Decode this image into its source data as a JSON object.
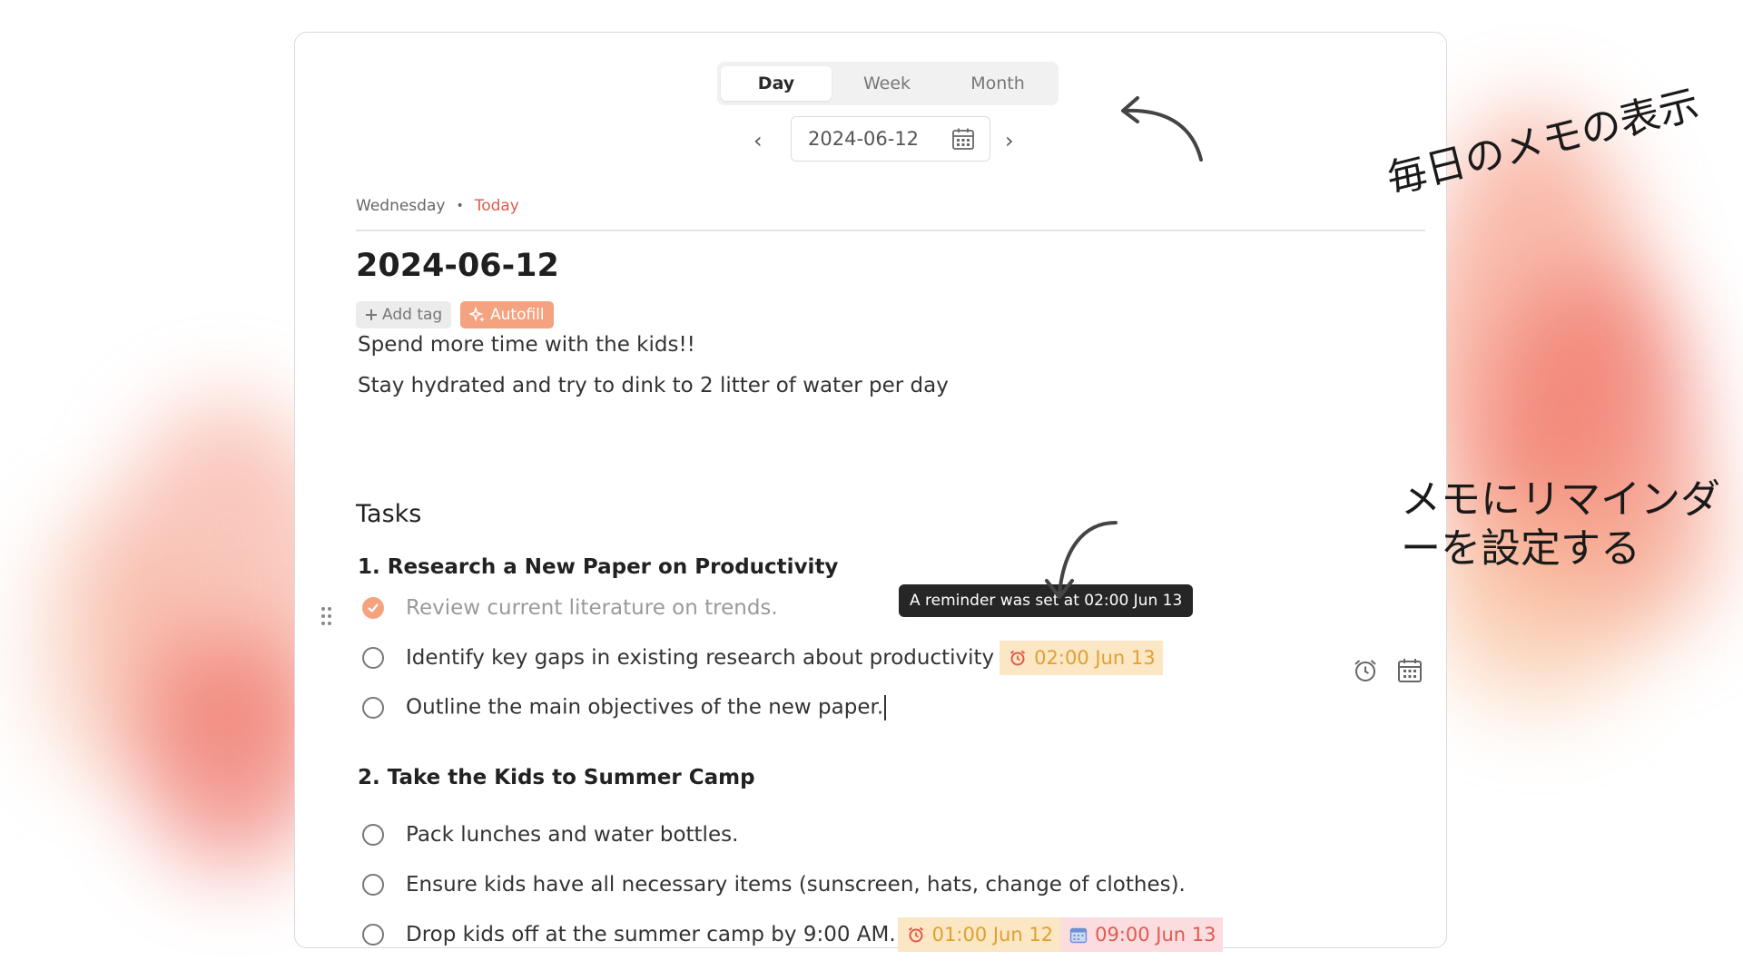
{
  "view_tabs": [
    "Day",
    "Week",
    "Month"
  ],
  "date_picker": {
    "value": "2024-06-12",
    "prev": "‹",
    "next": "›"
  },
  "day_header": {
    "weekday": "Wednesday",
    "separator": "•",
    "today": "Today"
  },
  "note": {
    "title": "2024-06-12",
    "add_tag_label": "Add tag",
    "autofill_label": "Autofill",
    "paragraphs": [
      "Spend more time with the kids!!",
      "Stay hydrated and try to dink to 2 litter of water per day"
    ],
    "tasks_heading": "Tasks",
    "sections": [
      {
        "title": "1. Research a New Paper on Productivity",
        "tasks": [
          {
            "text": "Review current literature on trends.",
            "done": true
          },
          {
            "text": "Identify key gaps in existing research about productivity",
            "done": false,
            "reminder": "02:00 Jun 13"
          },
          {
            "text": "Outline the main objectives of the new paper.",
            "done": false
          }
        ]
      },
      {
        "title": "2. Take the Kids to Summer Camp",
        "tasks": [
          {
            "text": "Pack lunches and water bottles.",
            "done": false
          },
          {
            "text": "Ensure kids have all necessary items (sunscreen, hats, change of clothes).",
            "done": false
          },
          {
            "text": "Drop kids off at the summer camp by 9:00 AM.",
            "done": false,
            "reminder": "01:00 Jun 12",
            "due": "09:00 Jun 13"
          }
        ]
      }
    ]
  },
  "tooltip": "A reminder was set at 02:00 Jun 13",
  "annotations": {
    "daily": "毎日のメモの表示",
    "reminder_line1": "メモにリマインダ",
    "reminder_line2": "ーを設定する"
  },
  "colors": {
    "accent": "#f5a27e",
    "today": "#e05a4f",
    "reminder_bg": "#fbe7c4",
    "due_bg": "#fbdde0"
  },
  "icons": [
    "calendar-icon",
    "plus-icon",
    "sparkle-icon",
    "check-icon",
    "alarm-icon",
    "drag-handle-icon"
  ]
}
